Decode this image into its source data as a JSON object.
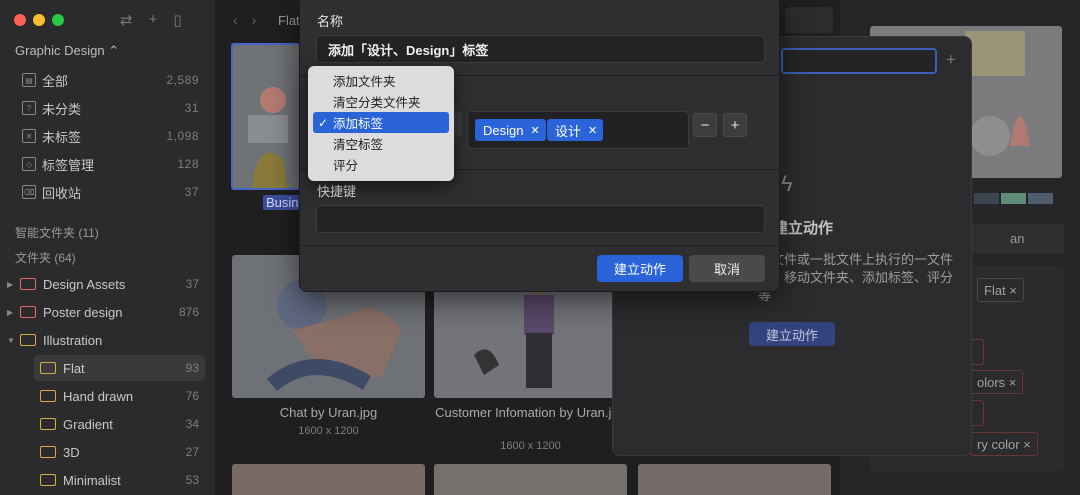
{
  "sidebar": {
    "library": "Graphic Design ⌃",
    "items": [
      {
        "label": "全部",
        "count": "2,589"
      },
      {
        "label": "未分类",
        "count": "31"
      },
      {
        "label": "未标签",
        "count": "1,098"
      },
      {
        "label": "标签管理",
        "count": "128"
      },
      {
        "label": "回收站",
        "count": "37"
      }
    ],
    "smart_folders": "智能文件夹 (11)",
    "folders_header": "文件夹 (64)",
    "folders": [
      {
        "label": "Design Assets",
        "count": "37"
      },
      {
        "label": "Poster design",
        "count": "876"
      },
      {
        "label": "Illustration",
        "count": ""
      },
      {
        "label": "Flat",
        "count": "93"
      },
      {
        "label": "Hand drawn",
        "count": "76"
      },
      {
        "label": "Gradient",
        "count": "34"
      },
      {
        "label": "3D",
        "count": "27"
      },
      {
        "label": "Minimalist",
        "count": "53"
      }
    ]
  },
  "main": {
    "path": "Flat",
    "selected_caption": "Busin",
    "thumbs": [
      {
        "caption": "Chat by Uran.jpg",
        "size": "1600 x 1200"
      },
      {
        "caption": "Customer Infomation by Uran.jpg",
        "size": "1600 x 1200"
      }
    ]
  },
  "inspector": {
    "field_tail": "an",
    "tags": [
      "Flat ×",
      "olors ×",
      "ry color ×"
    ]
  },
  "popover": {
    "title": "建立动作",
    "desc": "个文件或一批文件上执行的一文件夹、移动文件夹、添加标签、评分等",
    "button": "建立动作"
  },
  "dialog": {
    "name_label": "名称",
    "name_value": "添加「设计、Design」标签",
    "tags": [
      "Design",
      "设计"
    ],
    "minus": "−",
    "plus": "+",
    "shortcut_label": "快捷键",
    "shortcut_value": "",
    "confirm": "建立动作",
    "cancel": "取消"
  },
  "menu": {
    "items": [
      "添加文件夹",
      "清空分类文件夹",
      "添加标签",
      "清空标签",
      "评分"
    ],
    "selected": "添加标签",
    "check": "✓"
  },
  "colors": {
    "accent": "#2b63d9",
    "menu_bg": "#dcdcde",
    "dialog_bg": "#2f2f31"
  }
}
